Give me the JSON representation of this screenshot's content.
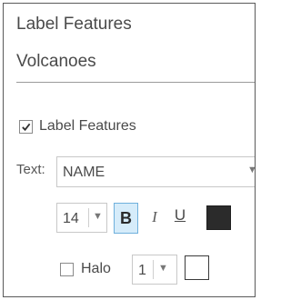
{
  "panel": {
    "title": "Label Features",
    "layer_name": "Volcanoes"
  },
  "label_toggle": {
    "label": "Label Features",
    "checked": true
  },
  "text_field": {
    "label": "Text:",
    "value": "NAME",
    "arrow_icon": "chevron-down-icon"
  },
  "font": {
    "size": "14",
    "bold_label": "B",
    "bold_active": true,
    "italic_label": "I",
    "underline_label": "U",
    "color": "#2b2b2b"
  },
  "halo": {
    "label": "Halo",
    "checked": false,
    "size": "1",
    "color": "#ffffff"
  },
  "colors": {
    "active_button_bg": "#d6ecfa",
    "active_button_border": "#6fb0dc"
  }
}
